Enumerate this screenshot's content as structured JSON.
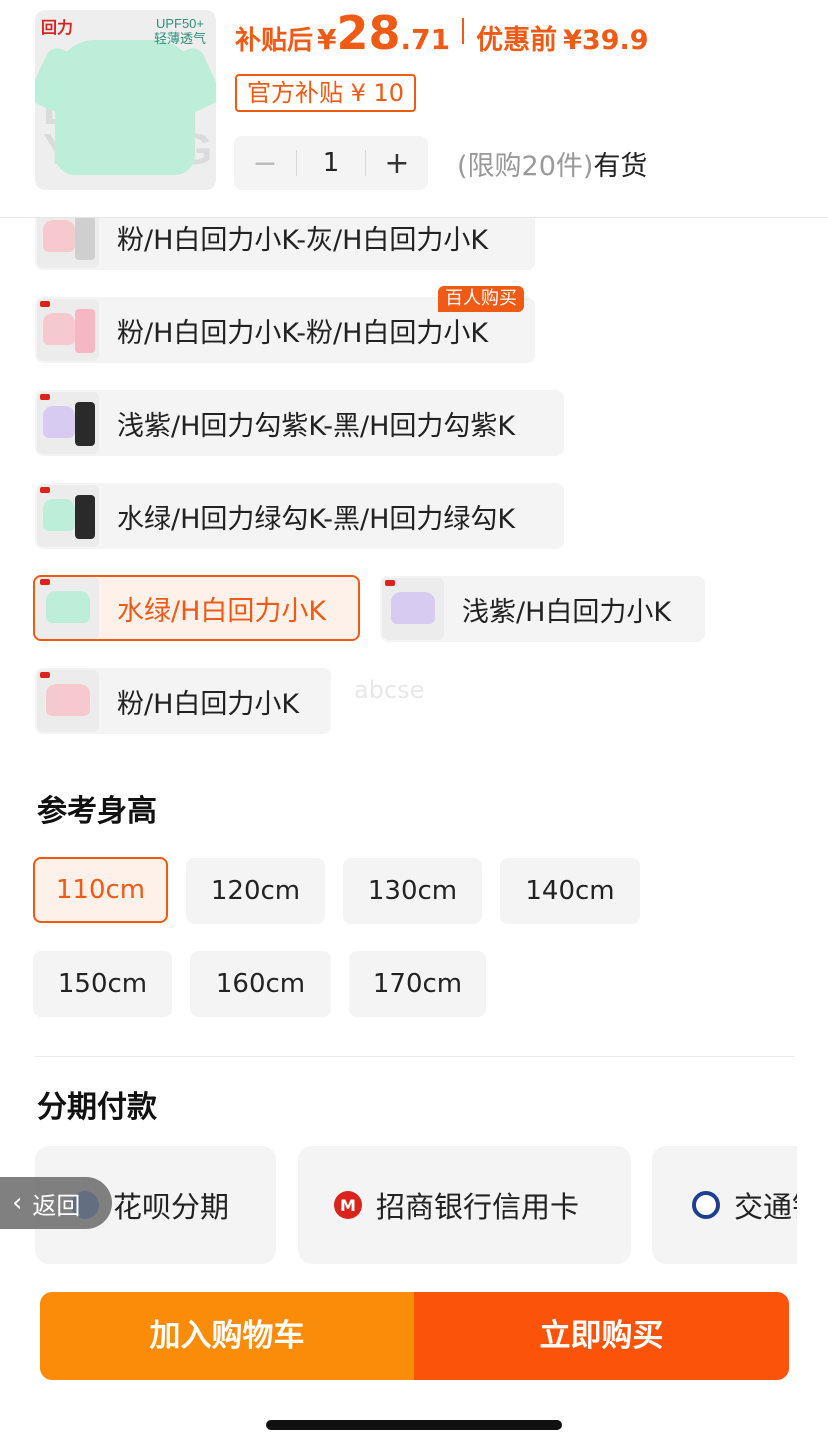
{
  "header": {
    "thumb_logo": "回力",
    "thumb_upf": "UPF50+",
    "thumb_tag": "轻薄透气",
    "price_after_label": "补贴后",
    "currency": "¥",
    "price_after_int": "28",
    "price_after_dec": ".71",
    "price_before_label": "优惠前",
    "price_before": "¥39.9",
    "subsidy_text": "官方补贴 ¥ 10",
    "quantity": "1",
    "minus": "−",
    "plus": "+",
    "limit_text": "(限购20件)",
    "stock_text": "有货"
  },
  "variants": [
    {
      "label": "粉/H白回力小K-灰/H白回力小K",
      "colors": [
        "#f6c9cf",
        "#cfcfcf"
      ]
    },
    {
      "label": "粉/H白回力小K-粉/H白回力小K",
      "colors": [
        "#f6c9cf",
        "#f6b7c3"
      ]
    },
    {
      "label": "浅紫/H回力勾紫K-黑/H回力勾紫K",
      "colors": [
        "#d7cbf2",
        "#2a2a2a"
      ]
    },
    {
      "label": "水绿/H回力绿勾K-黑/H回力绿勾K",
      "colors": [
        "#bdeed9",
        "#2a2a2a"
      ]
    },
    {
      "label": "水绿/H白回力小K",
      "colors": [
        "#bdeed9"
      ],
      "selected": true
    },
    {
      "label": "浅紫/H白回力小K",
      "colors": [
        "#d7cbf2"
      ]
    },
    {
      "label": "粉/H白回力小K",
      "colors": [
        "#f6c9cf"
      ]
    }
  ],
  "hot_badge": "百人购买",
  "watermark": "abcse",
  "height_section": {
    "title": "参考身高",
    "sizes": [
      "110cm",
      "120cm",
      "130cm",
      "140cm",
      "150cm",
      "160cm",
      "170cm"
    ],
    "selected": "110cm"
  },
  "installment_section": {
    "title": "分期付款",
    "options": [
      {
        "label": "花呗分期",
        "icon": "huabei-icon",
        "color": "#1677ff"
      },
      {
        "label": "招商银行信用卡",
        "icon": "cmb-icon",
        "color": "#d9231c"
      },
      {
        "label": "交通银行信用卡",
        "icon": "bocom-icon",
        "color": "#1d3f8f"
      }
    ]
  },
  "back_button": "返回",
  "back_chevron": "‹",
  "actions": {
    "add_to_cart": "加入购物车",
    "buy_now": "立即购买"
  },
  "colors": {
    "accent": "#ef5a14",
    "cart": "#fb8c0a",
    "buy": "#fb540a"
  }
}
